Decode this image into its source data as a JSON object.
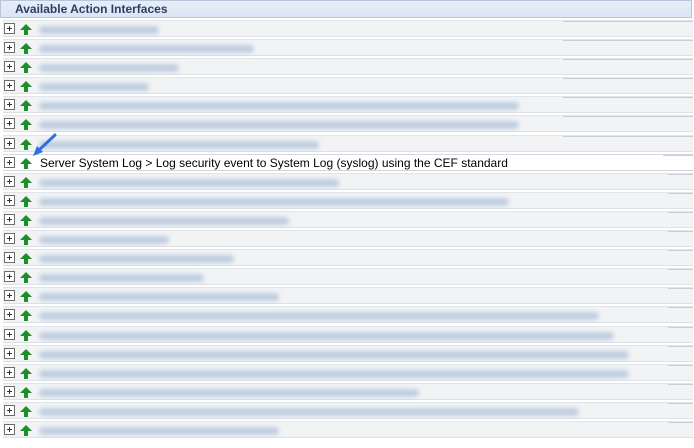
{
  "panel": {
    "title": "Available Action Interfaces"
  },
  "rows": [
    {
      "label": "",
      "blurred": true
    },
    {
      "label": "",
      "blurred": true
    },
    {
      "label": "",
      "blurred": true
    },
    {
      "label": "",
      "blurred": true
    },
    {
      "label": "",
      "blurred": true
    },
    {
      "label": "",
      "blurred": true
    },
    {
      "label": "",
      "blurred": true
    },
    {
      "label": "Server System Log > Log security event to System Log (syslog) using the CEF standard",
      "blurred": false
    },
    {
      "label": "",
      "blurred": true
    },
    {
      "label": "",
      "blurred": true
    },
    {
      "label": "",
      "blurred": true
    },
    {
      "label": "",
      "blurred": true
    },
    {
      "label": "",
      "blurred": true
    },
    {
      "label": "",
      "blurred": true
    },
    {
      "label": "",
      "blurred": true
    },
    {
      "label": "",
      "blurred": true
    },
    {
      "label": "",
      "blurred": true
    },
    {
      "label": "",
      "blurred": true
    },
    {
      "label": "",
      "blurred": true
    },
    {
      "label": "",
      "blurred": true
    },
    {
      "label": "",
      "blurred": true
    },
    {
      "label": "",
      "blurred": true
    }
  ],
  "icons": {
    "expand": "plus-box-icon",
    "move_up": "green-up-arrow-icon",
    "pointer": "blue-arrow-pointer-icon"
  },
  "colors": {
    "arrow_green": "#1f8d2a",
    "pointer_blue": "#2f6fe0",
    "header_text": "#2b3f64"
  }
}
